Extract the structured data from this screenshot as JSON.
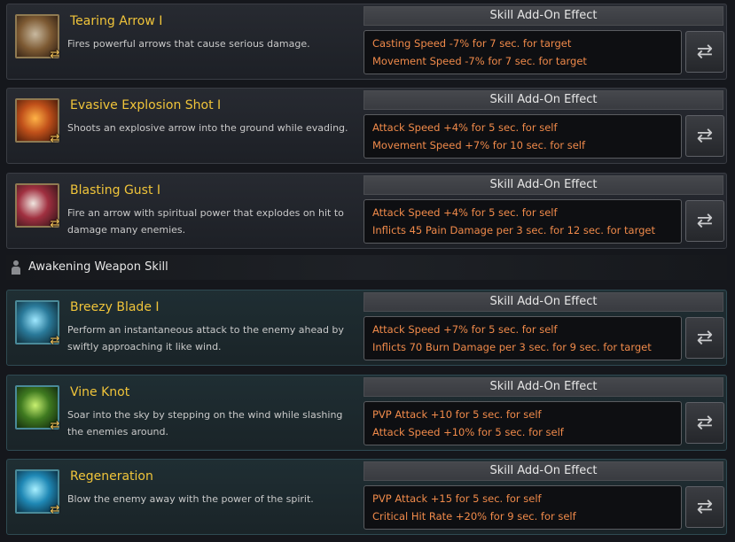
{
  "addon_header": "Skill Add-On Effect",
  "section_title": "Awakening Weapon Skill",
  "skills": [
    {
      "name": "Tearing Arrow I",
      "desc": "Fires powerful arrows that cause serious damage.",
      "effects": [
        "Casting Speed -7% for 7 sec. for target",
        "Movement Speed -7% for 7 sec. for target"
      ]
    },
    {
      "name": "Evasive Explosion Shot I",
      "desc": "Shoots an explosive arrow into the ground while evading.",
      "effects": [
        "Attack Speed +4% for 5 sec. for self",
        "Movement Speed +7% for 10 sec. for self"
      ]
    },
    {
      "name": "Blasting Gust I",
      "desc": "Fire an arrow with spiritual power that explodes on hit to damage many enemies.",
      "effects": [
        "Attack Speed +4% for 5 sec. for self",
        "Inflicts 45 Pain Damage per 3 sec. for 12 sec. for target"
      ]
    },
    {
      "name": "Breezy Blade I",
      "desc": "Perform an instantaneous attack to the enemy ahead by swiftly approaching it like wind.",
      "effects": [
        "Attack Speed +7% for 5 sec. for self",
        "Inflicts 70 Burn Damage per 3 sec. for 9 sec. for target"
      ]
    },
    {
      "name": "Vine Knot",
      "desc": "Soar into the sky by stepping on the wind while slashing the enemies around.",
      "effects": [
        "PVP Attack +10 for 5 sec. for self",
        "Attack Speed +10% for 5 sec. for self"
      ]
    },
    {
      "name": "Regeneration",
      "desc": "Blow the enemy away with the power of the spirit.",
      "effects": [
        "PVP Attack +15 for 5 sec. for self",
        "Critical Hit Rate +20% for 9 sec. for self"
      ]
    }
  ],
  "icons": {
    "skill_change": "arrows-cycle-icon",
    "section": "person-icon"
  }
}
